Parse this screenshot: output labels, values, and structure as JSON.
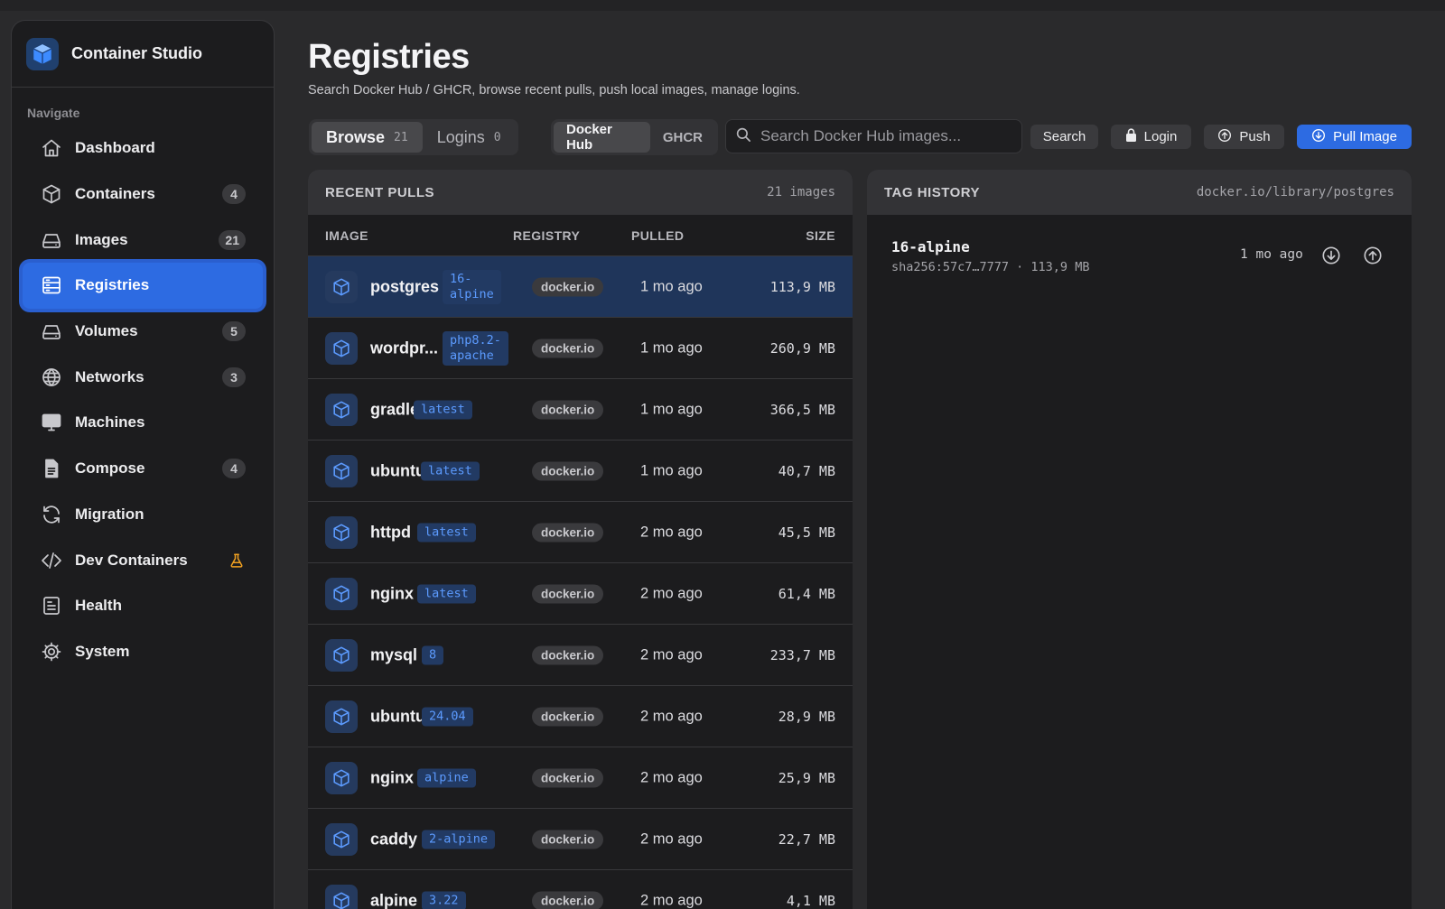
{
  "app": {
    "title": "Container Studio",
    "logo_icon": "cube-icon"
  },
  "sidebar": {
    "heading": "Navigate",
    "items": [
      {
        "label": "Dashboard",
        "icon": "home-icon",
        "badge": ""
      },
      {
        "label": "Containers",
        "icon": "box-icon",
        "badge": "4"
      },
      {
        "label": "Images",
        "icon": "disk-icon",
        "badge": "21"
      },
      {
        "label": "Registries",
        "icon": "server-icon",
        "badge": "",
        "active": true
      },
      {
        "label": "Volumes",
        "icon": "drive-icon",
        "badge": "5"
      },
      {
        "label": "Networks",
        "icon": "globe-icon",
        "badge": "3"
      },
      {
        "label": "Machines",
        "icon": "monitor-icon",
        "badge": ""
      },
      {
        "label": "Compose",
        "icon": "document-icon",
        "badge": "4"
      },
      {
        "label": "Migration",
        "icon": "refresh-icon",
        "badge": ""
      },
      {
        "label": "Dev Containers",
        "icon": "code-icon",
        "badge": "",
        "flag": "flask-icon"
      },
      {
        "label": "Health",
        "icon": "clipboard-icon",
        "badge": ""
      },
      {
        "label": "System",
        "icon": "gear-icon",
        "badge": ""
      }
    ]
  },
  "page": {
    "title": "Registries",
    "subtitle": "Search Docker Hub / GHCR, browse recent pulls, push local images, manage logins."
  },
  "tabs": [
    {
      "label": "Browse",
      "count": "21",
      "active": true
    },
    {
      "label": "Logins",
      "count": "0",
      "active": false
    }
  ],
  "registry_switch": [
    {
      "label": "Docker Hub",
      "active": true
    },
    {
      "label": "GHCR",
      "active": false
    }
  ],
  "search": {
    "placeholder": "Search Docker Hub images...",
    "value": ""
  },
  "actions": {
    "search_label": "Search",
    "login_label": "Login",
    "push_label": "Push",
    "pull_label": "Pull Image"
  },
  "recent_pulls": {
    "title": "RECENT PULLS",
    "count_label": "21 images",
    "columns": {
      "image": "IMAGE",
      "registry": "REGISTRY",
      "pulled": "PULLED",
      "size": "SIZE"
    },
    "rows": [
      {
        "name": "postgres",
        "tag": "16-\nalpine",
        "registry": "docker.io",
        "pulled": "1 mo ago",
        "size": "113,9 MB",
        "selected": true
      },
      {
        "name": "wordpr...",
        "tag": "php8.2-\napache",
        "registry": "docker.io",
        "pulled": "1 mo ago",
        "size": "260,9 MB"
      },
      {
        "name": "gradle",
        "tag": "latest",
        "registry": "docker.io",
        "pulled": "1 mo ago",
        "size": "366,5 MB"
      },
      {
        "name": "ubuntu",
        "tag": "latest",
        "registry": "docker.io",
        "pulled": "1 mo ago",
        "size": "40,7 MB"
      },
      {
        "name": "httpd",
        "tag": "latest",
        "registry": "docker.io",
        "pulled": "2 mo ago",
        "size": "45,5 MB"
      },
      {
        "name": "nginx",
        "tag": "latest",
        "registry": "docker.io",
        "pulled": "2 mo ago",
        "size": "61,4 MB"
      },
      {
        "name": "mysql",
        "tag": "8",
        "registry": "docker.io",
        "pulled": "2 mo ago",
        "size": "233,7 MB"
      },
      {
        "name": "ubuntu",
        "tag": "24.04",
        "registry": "docker.io",
        "pulled": "2 mo ago",
        "size": "28,9 MB"
      },
      {
        "name": "nginx",
        "tag": "alpine",
        "registry": "docker.io",
        "pulled": "2 mo ago",
        "size": "25,9 MB"
      },
      {
        "name": "caddy",
        "tag": "2-alpine",
        "registry": "docker.io",
        "pulled": "2 mo ago",
        "size": "22,7 MB"
      },
      {
        "name": "alpine",
        "tag": "3.22",
        "registry": "docker.io",
        "pulled": "2 mo ago",
        "size": "4,1 MB"
      }
    ]
  },
  "tag_history": {
    "title": "TAG HISTORY",
    "image_ref": "docker.io/library/postgres",
    "entries": [
      {
        "tag": "16-alpine",
        "meta": "sha256:57c7…7777 · 113,9 MB",
        "time": "1 mo ago"
      }
    ]
  },
  "colors": {
    "accent": "#2d6be2",
    "tag_text": "#5c9bff",
    "flask": "#f0a020"
  }
}
